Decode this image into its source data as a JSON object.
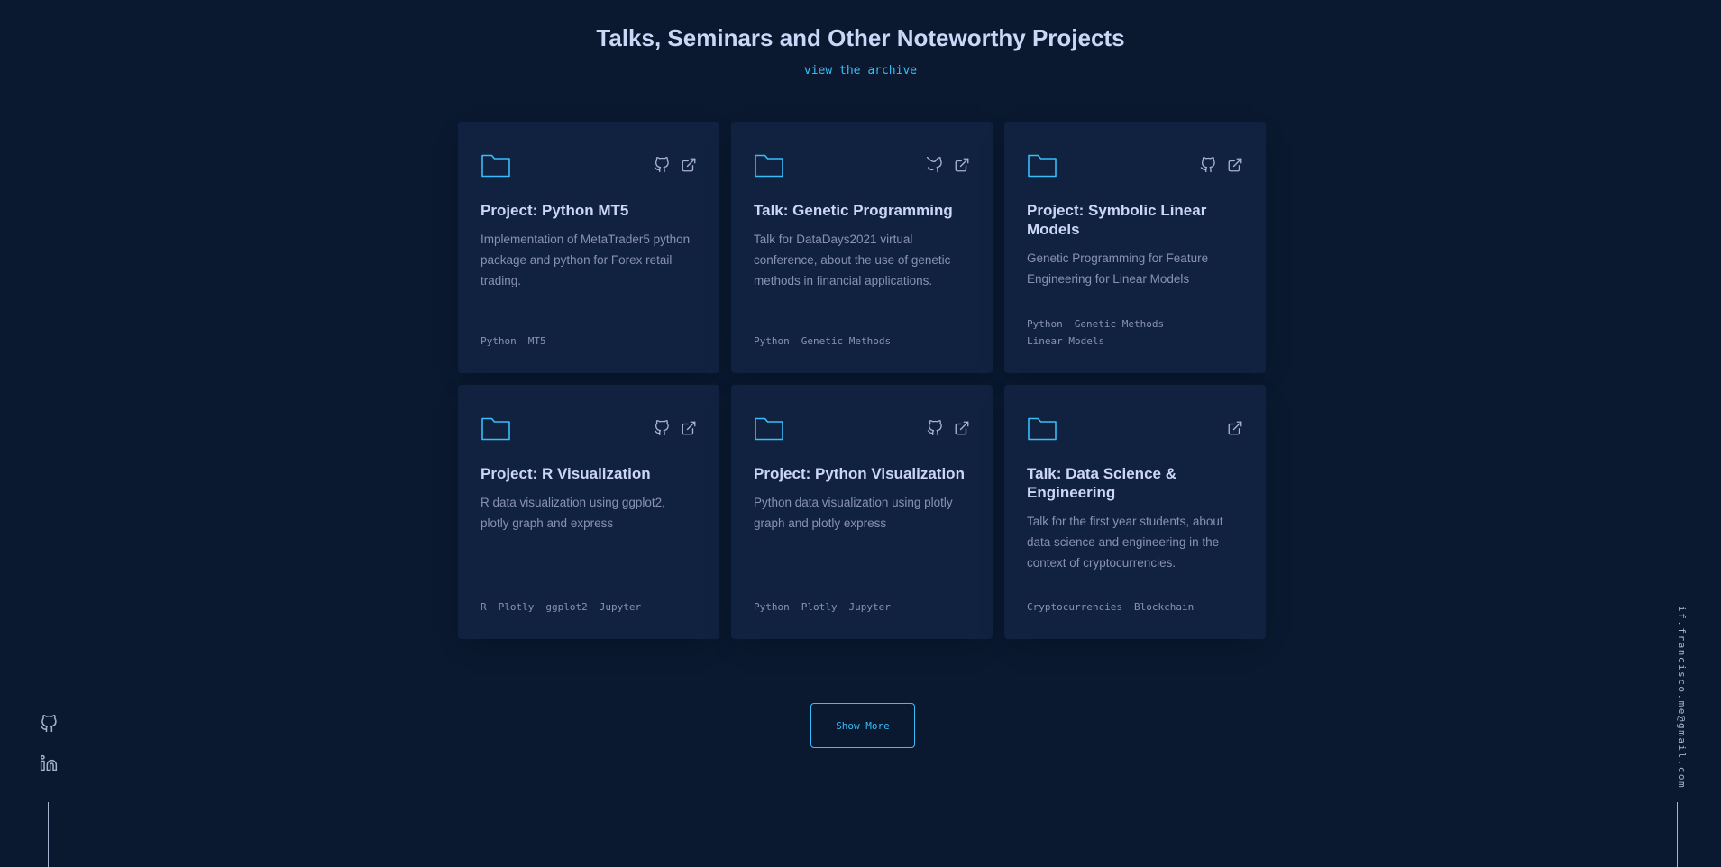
{
  "section": {
    "title": "Talks, Seminars and Other Noteworthy Projects",
    "archive_link": "view the archive"
  },
  "colors": {
    "background": "#0a192f",
    "card": "#112240",
    "accent": "#38bdf8",
    "heading": "#ccd6f6",
    "text": "#8892b0"
  },
  "projects": [
    {
      "title": "Project: Python MT5",
      "description": "Implementation of MetaTrader5 python package and python for Forex retail trading.",
      "tags": [
        "Python",
        "MT5"
      ],
      "icons": [
        "folder-icon",
        "github-icon",
        "external-link-icon"
      ]
    },
    {
      "title": "Talk: Genetic Programming",
      "description": "Talk for DataDays2021 virtual conference, about the use of genetic methods in financial applications.",
      "tags": [
        "Python",
        "Genetic Methods"
      ],
      "icons": [
        "folder-icon",
        "github-icon",
        "external-link-icon"
      ]
    },
    {
      "title": "Project: Symbolic Linear Models",
      "description": "Genetic Programming for Feature Engineering for Linear Models",
      "tags": [
        "Python",
        "Genetic Methods",
        "Linear Models"
      ],
      "icons": [
        "folder-icon",
        "github-icon",
        "external-link-icon"
      ]
    },
    {
      "title": "Project: R Visualization",
      "description": "R data visualization using ggplot2, plotly graph and express",
      "tags": [
        "R",
        "Plotly",
        "ggplot2",
        "Jupyter"
      ],
      "icons": [
        "folder-icon",
        "github-icon",
        "external-link-icon"
      ]
    },
    {
      "title": "Project: Python Visualization",
      "description": "Python data visualization using plotly graph and plotly express",
      "tags": [
        "Python",
        "Plotly",
        "Jupyter"
      ],
      "icons": [
        "folder-icon",
        "github-icon",
        "external-link-icon"
      ]
    },
    {
      "title": "Talk: Data Science & Engineering",
      "description": "Talk for the first year students, about data science and engineering in the context of cryptocurrencies.",
      "tags": [
        "Cryptocurrencies",
        "Blockchain"
      ],
      "icons": [
        "folder-icon",
        "external-link-icon"
      ]
    }
  ],
  "show_more_label": "Show More",
  "social": {
    "icons": [
      "github-icon",
      "linkedin-icon"
    ]
  },
  "email": "if.francisco.me@gmail.com"
}
